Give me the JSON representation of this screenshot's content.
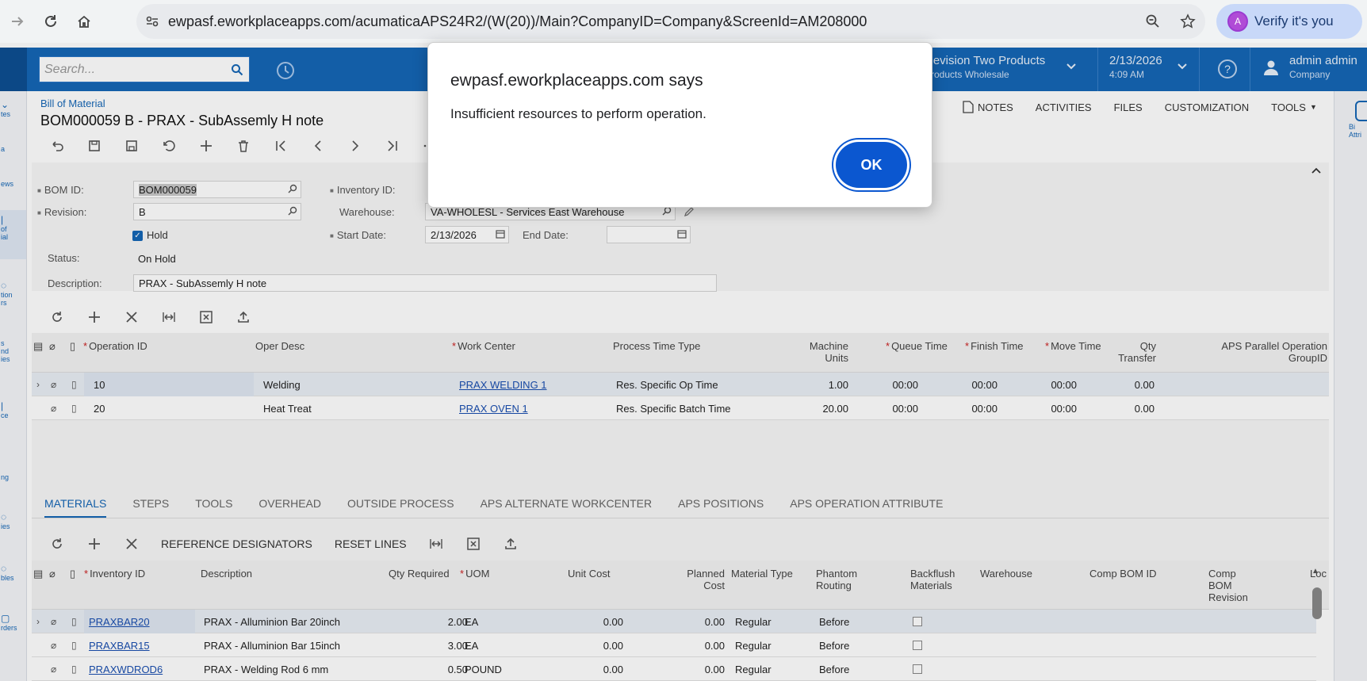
{
  "browser": {
    "url": "ewpasf.eworkplaceapps.com/acumaticaAPS24R2/(W(20))/Main?CompanyID=Company&ScreenId=AM208000",
    "verify_label": "Verify it's you",
    "avatar_letter": "A"
  },
  "appbar": {
    "search_placeholder": "Search...",
    "company_line1": "Revision Two Products",
    "company_line2": "Products Wholesale",
    "date": "2/13/2026",
    "time": "4:09 AM",
    "user_name": "admin admin",
    "user_company": "Company"
  },
  "leftnav": [
    "tes",
    "a",
    "ews",
    "of",
    "ial",
    "tion",
    "rs",
    "s",
    "nd",
    "ies",
    "ce",
    "ng",
    "ies",
    "bles",
    "rders"
  ],
  "rightbar_label": "Bi Attri",
  "page": {
    "breadcrumb": "Bill of Material",
    "title": "BOM000059 B - PRAX - SubAssemly H note"
  },
  "top_actions": [
    "NOTES",
    "ACTIVITIES",
    "FILES",
    "CUSTOMIZATION",
    "TOOLS"
  ],
  "form": {
    "bom_id_label": "BOM ID:",
    "bom_id": "BOM000059",
    "revision_label": "Revision:",
    "revision": "B",
    "hold_label": "Hold",
    "status_label": "Status:",
    "status": "On Hold",
    "description_label": "Description:",
    "description": "PRAX - SubAssemly H note",
    "inventory_label": "Inventory ID:",
    "warehouse_label": "Warehouse:",
    "warehouse": "VA-WHOLESL - Services East Warehouse",
    "start_date_label": "Start Date:",
    "start_date": "2/13/2026",
    "end_date_label": "End Date:"
  },
  "operations": {
    "headers": {
      "operation_id": "Operation ID",
      "oper_desc": "Oper Desc",
      "work_center": "Work Center",
      "process_time_type": "Process Time Type",
      "machine_units_1": "Machine",
      "machine_units_2": "Units",
      "queue_time": "Queue Time",
      "finish_time": "Finish Time",
      "move_time": "Move Time",
      "qty_transfer_1": "Qty",
      "qty_transfer_2": "Transfer",
      "aps_1": "APS Parallel Operation",
      "aps_2": "GroupID"
    },
    "rows": [
      {
        "id": "10",
        "desc": "Welding",
        "work_center": "PRAX WELDING 1",
        "ptt": "Res. Specific Op Time",
        "units": "1.00",
        "queue": "00:00",
        "finish": "00:00",
        "move": "00:00",
        "qty": "0.00"
      },
      {
        "id": "20",
        "desc": "Heat Treat",
        "work_center": "PRAX OVEN 1",
        "ptt": "Res. Specific Batch Time",
        "units": "20.00",
        "queue": "00:00",
        "finish": "00:00",
        "move": "00:00",
        "qty": "0.00"
      }
    ]
  },
  "tabs": [
    "MATERIALS",
    "STEPS",
    "TOOLS",
    "OVERHEAD",
    "OUTSIDE PROCESS",
    "APS ALTERNATE WORKCENTER",
    "APS POSITIONS",
    "APS OPERATION ATTRIBUTE"
  ],
  "materials_toolbar": {
    "ref_designators": "REFERENCE DESIGNATORS",
    "reset_lines": "RESET LINES"
  },
  "materials": {
    "headers": {
      "inventory_id": "Inventory ID",
      "description": "Description",
      "qty_required": "Qty Required",
      "uom": "UOM",
      "unit_cost": "Unit Cost",
      "planned_1": "Planned",
      "planned_2": "Cost",
      "material_type": "Material Type",
      "phantom_1": "Phantom",
      "phantom_2": "Routing",
      "backflush_1": "Backflush",
      "backflush_2": "Materials",
      "warehouse": "Warehouse",
      "comp_bom_id": "Comp BOM ID",
      "comp_rev_1": "Comp",
      "comp_rev_2": "BOM",
      "comp_rev_3": "Revision",
      "loc": "Loc"
    },
    "rows": [
      {
        "inv": "PRAXBAR20",
        "desc": "PRAX - Alluminion Bar 20inch",
        "qty": "2.00",
        "uom": "EA",
        "unit": "0.00",
        "planned": "0.00",
        "type": "Regular",
        "phantom": "Before"
      },
      {
        "inv": "PRAXBAR15",
        "desc": "PRAX - Alluminion Bar 15inch",
        "qty": "3.00",
        "uom": "EA",
        "unit": "0.00",
        "planned": "0.00",
        "type": "Regular",
        "phantom": "Before"
      },
      {
        "inv": "PRAXWDROD6",
        "desc": "PRAX - Welding Rod 6 mm",
        "qty": "0.50",
        "uom": "POUND",
        "unit": "0.00",
        "planned": "0.00",
        "type": "Regular",
        "phantom": "Before"
      }
    ]
  },
  "dialog": {
    "title": "ewpasf.eworkplaceapps.com says",
    "message": "Insufficient resources to perform operation.",
    "ok_label": "OK"
  }
}
